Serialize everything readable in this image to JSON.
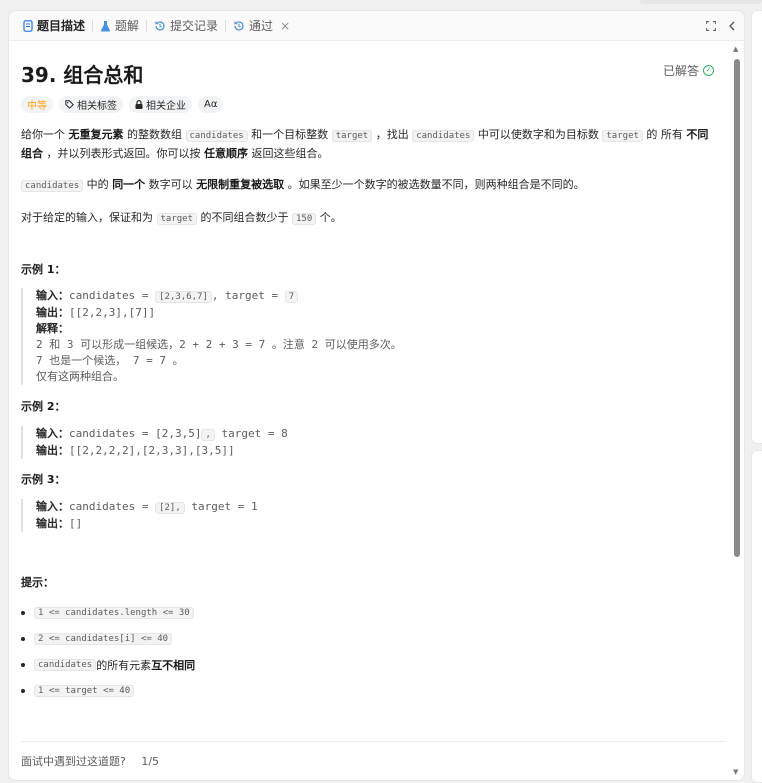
{
  "tabs": [
    {
      "label": "题目描述",
      "icon": "description-icon",
      "active": true
    },
    {
      "label": "题解",
      "icon": "flask-icon",
      "active": false
    },
    {
      "label": "提交记录",
      "icon": "history-icon",
      "active": false
    },
    {
      "label": "通过",
      "icon": "history-icon",
      "active": false,
      "closable": true
    }
  ],
  "tab_close_glyph": "×",
  "toolbar": {
    "fullscreen_icon": "fullscreen-icon",
    "collapse_icon": "chevron-left-icon"
  },
  "problem": {
    "title": "39. 组合总和",
    "solved_label": "已解答",
    "difficulty": "中等",
    "tag_related": "相关标签",
    "tag_company": "相关企业",
    "tag_font": "Aα"
  },
  "description": {
    "p1": {
      "t1": "给你一个 ",
      "b1": "无重复元素",
      "t2": " 的整数数组 ",
      "c1": "candidates",
      "t3": " 和一个目标整数 ",
      "c2": "target",
      "t4": " ，找出 ",
      "c3": "candidates",
      "t5": " 中可以使数字和为目标数 ",
      "c4": "target",
      "t6": " 的 所有 ",
      "b2": "不同组合",
      "t7": " ，并以列表形式返回。你可以按 ",
      "b3": "任意顺序",
      "t8": " 返回这些组合。"
    },
    "p2": {
      "c1": "candidates",
      "t1": " 中的 ",
      "b1": "同一个",
      "t2": " 数字可以 ",
      "b2": "无限制重复被选取",
      "t3": " 。如果至少一个数字的被选数量不同，则两种组合是不同的。"
    },
    "p3": {
      "t1": "对于给定的输入，保证和为 ",
      "c1": "target",
      "t2": " 的不同组合数少于 ",
      "c2": "150",
      "t3": " 个。"
    }
  },
  "examples": [
    {
      "title": "示例 1：",
      "input_label": "输入：",
      "input_a": "candidates = ",
      "input_code": "[2,3,6,7]",
      "input_b": ", target = ",
      "input_code2": "7",
      "output_label": "输出：",
      "output": "[[2,2,3],[7]]",
      "explain_label": "解释：",
      "explain": [
        "2 和 3 可以形成一组候选，2 + 2 + 3 = 7 。注意 2 可以使用多次。",
        "7 也是一个候选， 7 = 7 。",
        "仅有这两种组合。"
      ]
    },
    {
      "title": "示例 2：",
      "input_label": "输入：",
      "input_a": "candidates = [2,3,5]",
      "input_code": ",",
      "input_b": " target = 8",
      "output_label": "输出：",
      "output": "[[2,2,2,2],[2,3,3],[3,5]]"
    },
    {
      "title": "示例 3：",
      "input_label": "输入：",
      "input_a": "candidates = ",
      "input_code": "[2],",
      "input_b": " target = 1",
      "output_label": "输出：",
      "output": "[]"
    }
  ],
  "hints": {
    "title": "提示：",
    "items": [
      "1 <= candidates.length <= 30",
      "2 <= candidates[i] <= 40",
      "1 <= target <= 40"
    ],
    "distinct_code": "candidates",
    "distinct_t1": " 的所有元素 ",
    "distinct_b1": "互不相同"
  },
  "interview": {
    "question": "面试中遇到过这道题?",
    "count": "1/5"
  },
  "colors": {
    "accent": "#ffa116",
    "success": "#2db55d",
    "text": "#262626"
  }
}
